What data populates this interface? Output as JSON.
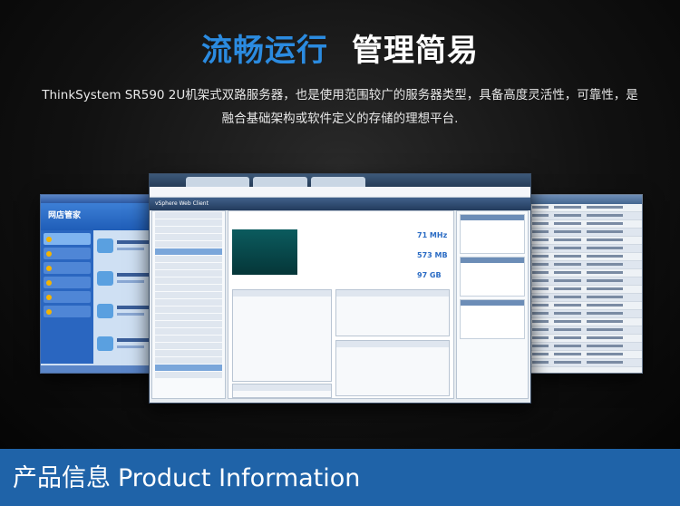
{
  "headline": {
    "left": "流畅运行",
    "right": "管理简易"
  },
  "description": "ThinkSystem SR590 2U机架式双路服务器，也是使用范围较广的服务器类型，具备高度灵活性，可靠性，是融合基础架构或软件定义的存储的理想平台.",
  "screens": {
    "left_title": "网店管家",
    "main_app": "vSphere Web Client",
    "main_stats": [
      "71 MHz",
      "573 MB",
      "97 GB"
    ]
  },
  "footer": {
    "title_cn": "产品信息",
    "title_en": "Product Information"
  },
  "colors": {
    "accent_blue": "#2b8be0",
    "bar_blue": "#1f63a8"
  }
}
